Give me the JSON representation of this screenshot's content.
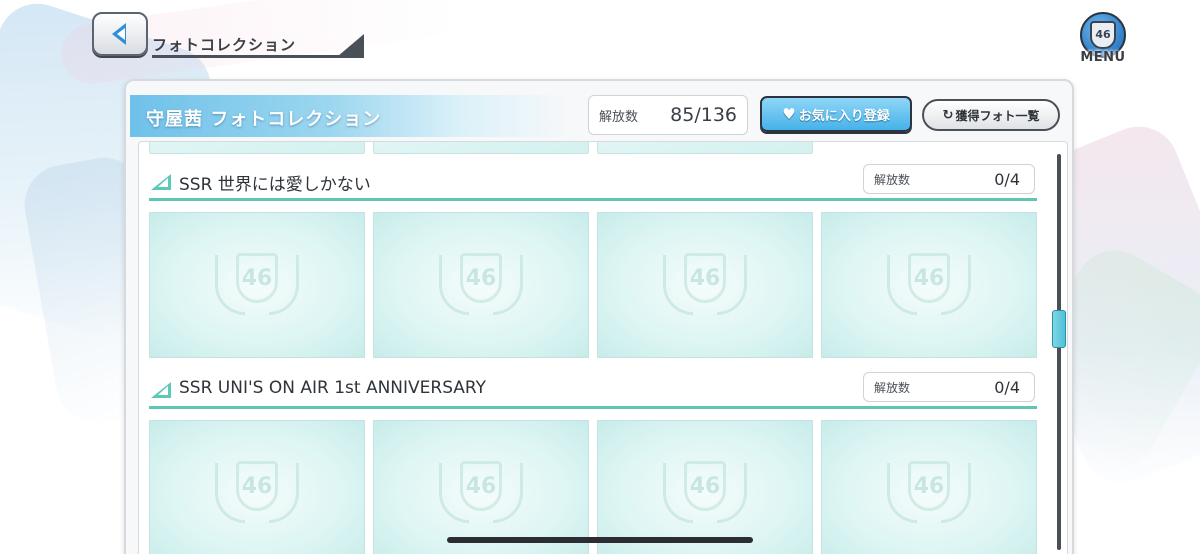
{
  "header": {
    "title": "フォトコレクション",
    "menu_badge": "46",
    "menu_label": "MENU"
  },
  "panel": {
    "title": "守屋茜 フォトコレクション",
    "unlock_label": "解放数",
    "unlock_value": "85/136",
    "favorite_button": "お気に入り登録",
    "acquired_list_button": "獲得フォト一覧"
  },
  "sections": [
    {
      "name": "SSR 世界には愛しかない",
      "count_label": "解放数",
      "count_value": "0/4",
      "cards": [
        "46",
        "46",
        "46",
        "46"
      ]
    },
    {
      "name": "SSR UNI'S ON AIR 1st ANNIVERSARY",
      "count_label": "解放数",
      "count_value": "0/4",
      "cards": [
        "46",
        "46",
        "46",
        "46"
      ]
    }
  ],
  "colors": {
    "accent_blue": "#46b2e8",
    "section_green": "#61c5b5",
    "card_tint": "#dcf5f3"
  },
  "icons": {
    "back": "chevron-left-icon",
    "menu": "emblem-46-icon",
    "favorite": "heart-icon",
    "list": "photo-list-icon",
    "crest": "crest-46-icon"
  }
}
